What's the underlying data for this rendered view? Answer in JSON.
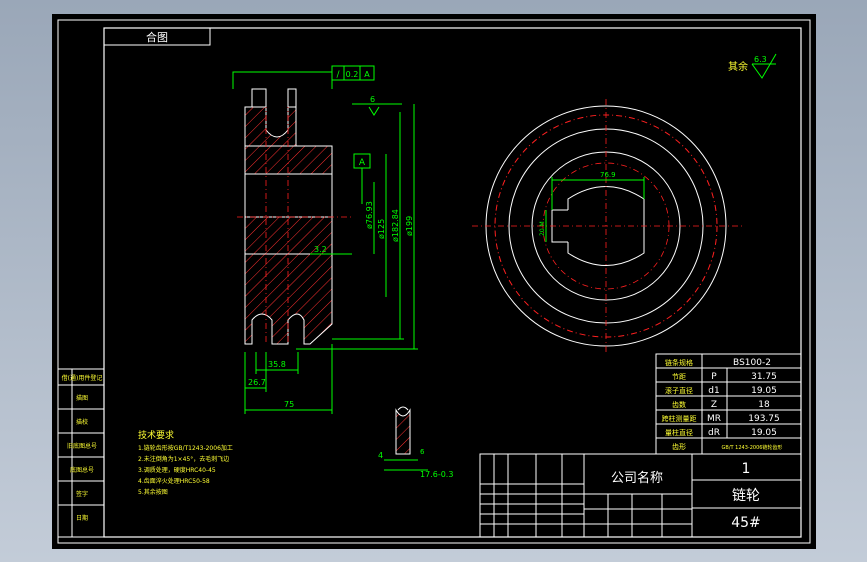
{
  "drawing": {
    "frame_title": "合图",
    "roughness_note": "其余",
    "roughness_value": "6.3",
    "surface_roughness_a": "6.3",
    "surface_roughness_b": "3.2",
    "datum_label": "A",
    "fcf": {
      "symbol": "/",
      "tolerance": "0.2",
      "datum": "A"
    }
  },
  "dimensions": {
    "d_bore": "ø76.93",
    "d_hub": "ø125",
    "d_root": "ø182.84",
    "d_tip": "ø199",
    "w_pitch": "35.8",
    "w_tooth": "26.7",
    "w_total": "75",
    "key_width": "76.9",
    "key_depth": "20 M",
    "tooth_w": "4",
    "tooth_r": "6",
    "tooth_profile": "17.6-0.3"
  },
  "tech_requirements": {
    "heading": "技术要求",
    "items": [
      "1.链轮齿形按GB/T1243-2006加工",
      "2.未注倒角为1×45°，去毛刺飞边",
      "3.调质处理，硬度HRC40-45",
      "4.齿面淬火处理HRC50-58",
      "5.其余按图"
    ]
  },
  "params": {
    "header": [
      "链条规格",
      "BS100-2"
    ],
    "rows": [
      {
        "name": "节距",
        "sym": "P",
        "val": "31.75"
      },
      {
        "name": "滚子直径",
        "sym": "d1",
        "val": "19.05"
      },
      {
        "name": "齿数",
        "sym": "Z",
        "val": "18"
      },
      {
        "name": "跨柱测量距",
        "sym": "MR",
        "val": "193.75"
      },
      {
        "name": "量柱直径",
        "sym": "dR",
        "val": "19.05"
      },
      {
        "name": "齿形",
        "sym": "",
        "val": "GB/T 1243-2006链轮齿形"
      }
    ]
  },
  "title_block": {
    "company": "公司名称",
    "quantity": "1",
    "part_name": "链轮",
    "material": "45#"
  },
  "left_strip": {
    "labels": [
      "借(通)用件登记",
      "描图",
      "描校",
      "旧底图总号",
      "底图总号",
      "签字",
      "日期"
    ]
  }
}
